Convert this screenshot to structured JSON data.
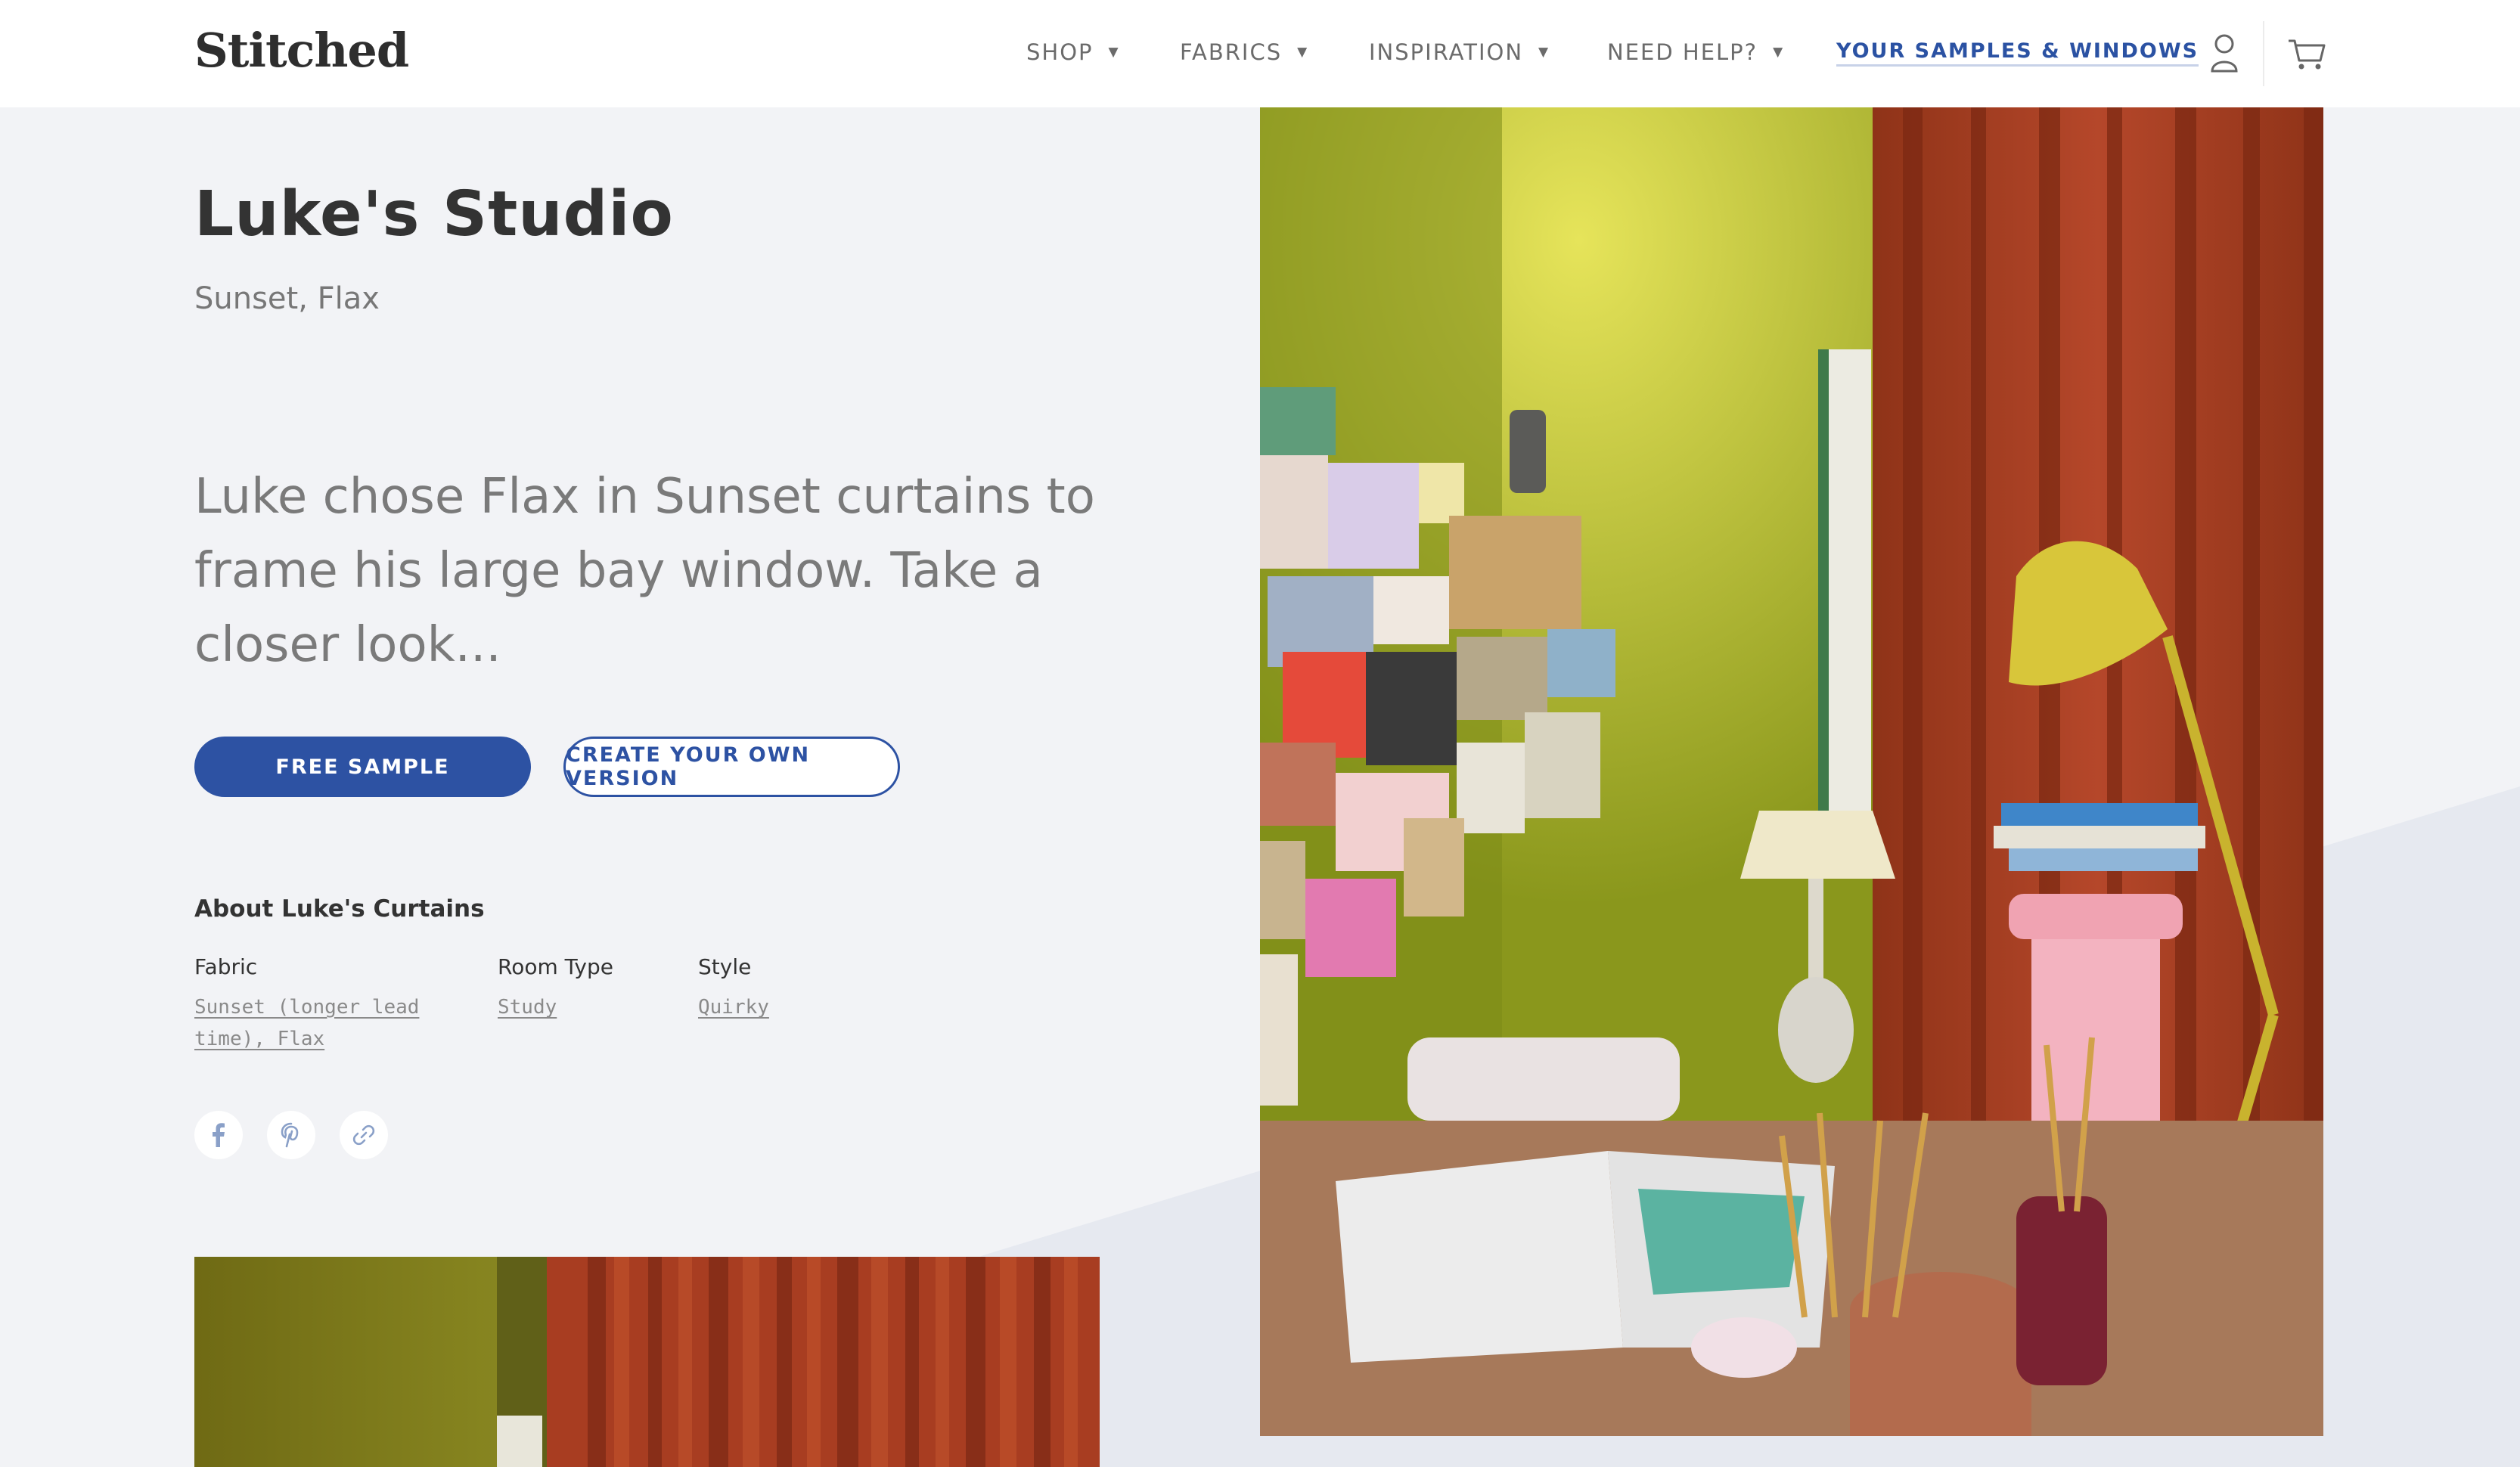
{
  "brand": {
    "logo_text": "Stitched"
  },
  "nav": {
    "items": [
      {
        "label": "SHOP"
      },
      {
        "label": "FABRICS"
      },
      {
        "label": "INSPIRATION"
      },
      {
        "label": "NEED HELP?"
      }
    ],
    "samples_label": "YOUR SAMPLES & WINDOWS"
  },
  "page": {
    "title": "Luke's Studio",
    "subtitle": "Sunset, Flax",
    "intro": "Luke chose Flax in Sunset curtains to frame his large bay window. Take a closer look...",
    "free_sample_label": "FREE SAMPLE",
    "create_label": "CREATE YOUR OWN VERSION"
  },
  "about": {
    "heading": "About Luke's Curtains",
    "fabric_label": "Fabric",
    "fabric_value": "Sunset (longer lead time), Flax",
    "room_label": "Room Type",
    "room_value": "Study",
    "style_label": "Style",
    "style_value": "Quirky"
  },
  "icons": {
    "user": "user-icon",
    "cart": "cart-icon",
    "facebook": "facebook-icon",
    "pinterest": "pinterest-icon",
    "link": "link-icon"
  },
  "colors": {
    "accent": "#2d52a3",
    "background": "#f2f3f6",
    "curtain": "#a63e22",
    "wall": "#8c9a1e"
  }
}
